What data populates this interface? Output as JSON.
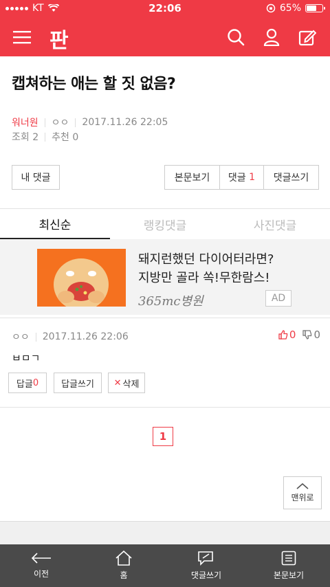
{
  "status_bar": {
    "carrier": "KT",
    "time": "22:06",
    "battery_label": "65%",
    "battery_level": 0.65
  },
  "header": {
    "logo": "판",
    "icons": [
      "menu-icon",
      "search-icon",
      "user-icon",
      "edit-icon"
    ]
  },
  "post": {
    "title": "캡쳐하는 애는 할 짓 없음?",
    "author": "워너원",
    "nickname": "ㅇㅇ",
    "date": "2017.11.26 22:05",
    "views": "조회 2",
    "recommend": "추천 0"
  },
  "actions": {
    "my_comments": "내 댓글",
    "view_post": "본문보기",
    "comments_label": "댓글",
    "comments_count": "1",
    "write_comment": "댓글쓰기"
  },
  "tabs": [
    {
      "label": "최신순",
      "active": true
    },
    {
      "label": "랭킹댓글",
      "active": false
    },
    {
      "label": "사진댓글",
      "active": false
    }
  ],
  "ad": {
    "line1": "돼지런했던 다이어터라면?",
    "line2": "지방만 골라 쏙!무한람스!",
    "brand": "365mc병원",
    "tag": "AD"
  },
  "comment": {
    "author": "ㅇㅇ",
    "date": "2017.11.26 22:06",
    "likes": "0",
    "dislikes": "0",
    "body": "ㅂㅁㄱ",
    "reply_label": "답글",
    "reply_count": "0",
    "write_reply": "답글쓰기",
    "delete_label": "삭제"
  },
  "pagination": {
    "current": "1"
  },
  "to_top": "맨위로",
  "bottom_nav": [
    {
      "label": "이전",
      "icon": "back-arrow-icon"
    },
    {
      "label": "홈",
      "icon": "home-icon"
    },
    {
      "label": "댓글쓰기",
      "icon": "comment-write-icon"
    },
    {
      "label": "본문보기",
      "icon": "document-icon"
    }
  ],
  "colors": {
    "brand": "#ef3a45",
    "bottom_bar": "#4a4a4a"
  }
}
